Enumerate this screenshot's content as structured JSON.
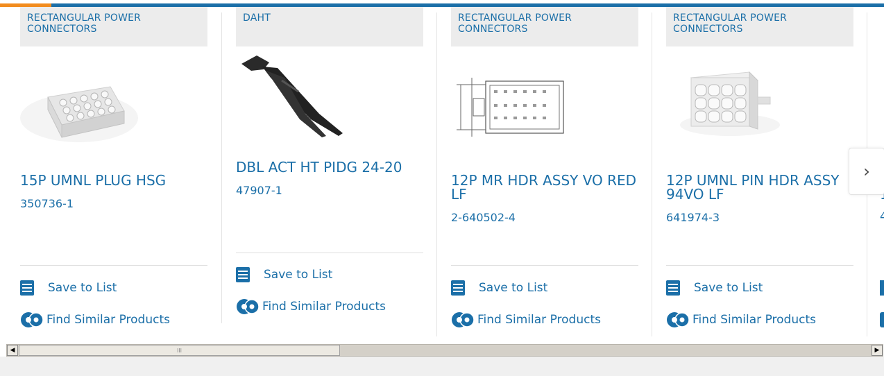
{
  "carousel": {
    "cards": [
      {
        "category": "RECTANGULAR POWER CONNECTORS",
        "title": "15P UMNL PLUG HSG",
        "part_number": "350736-1",
        "image": "connector-plug-housing-image",
        "save_label": "Save to List",
        "similar_label": "Find Similar Products"
      },
      {
        "category": "DAHT",
        "title": "DBL ACT HT PIDG 24-20",
        "part_number": "47907-1",
        "image": "crimp-tool-image",
        "save_label": "Save to List",
        "similar_label": "Find Similar Products"
      },
      {
        "category": "RECTANGULAR POWER CONNECTORS",
        "title": "12P MR HDR ASSY VO RED LF",
        "part_number": "2-640502-4",
        "image": "header-assembly-drawing-image",
        "save_label": "Save to List",
        "similar_label": "Find Similar Products"
      },
      {
        "category": "RECTANGULAR POWER CONNECTORS",
        "title": "12P UMNL PIN HDR ASSY 94VO LF",
        "part_number": "641974-3",
        "image": "pin-header-image",
        "save_label": "Save to List",
        "similar_label": "Find Similar Products"
      }
    ],
    "next_icon": "chevron-right-icon",
    "partial_title_char": "1",
    "partial_pn_char": "4"
  },
  "scrollbar": {
    "thumb_grip": "III",
    "left_arrow": "◀",
    "right_arrow": "▶"
  },
  "colors": {
    "accent": "#1b6fa8",
    "highlight": "#f28c1e"
  }
}
